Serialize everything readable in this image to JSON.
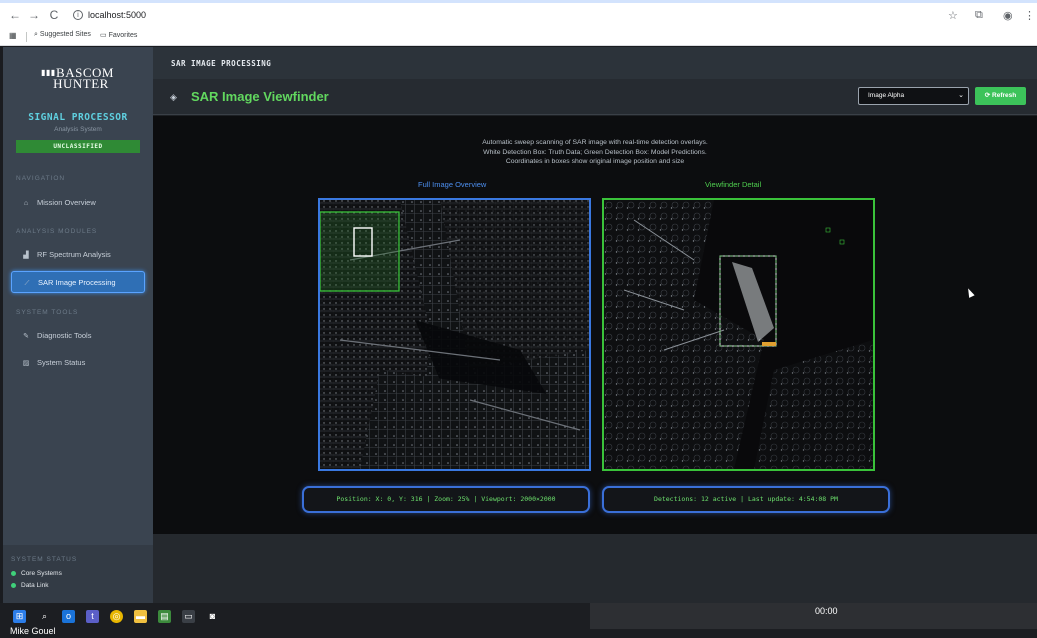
{
  "browser": {
    "url": "localhost:5000",
    "bookmarks": [
      "Suggested Sites",
      "Favorites"
    ]
  },
  "sidebar": {
    "logo_line1": "BASCOM",
    "logo_line2": "HUNTER",
    "app_title": "SIGNAL PROCESSOR",
    "app_subtitle": "Analysis System",
    "classification": "UNCLASSIFIED",
    "sections": {
      "navigation": "NAVIGATION",
      "analysis_modules": "ANALYSIS MODULES",
      "system_tools": "SYSTEM TOOLS"
    },
    "items": [
      {
        "label": "Mission Overview",
        "icon": "home-icon"
      },
      {
        "label": "RF Spectrum Analysis",
        "icon": "signal-icon"
      },
      {
        "label": "SAR Image Processing",
        "icon": "wand-icon",
        "active": true
      },
      {
        "label": "Diagnostic Tools",
        "icon": "wrench-icon"
      },
      {
        "label": "System Status",
        "icon": "chart-icon"
      }
    ],
    "status": {
      "heading": "SYSTEM STATUS",
      "lines": [
        "Core Systems",
        "Data Link"
      ],
      "ok_color": "#3fd07a"
    }
  },
  "topbar": {
    "title": "SAR IMAGE PROCESSING"
  },
  "header": {
    "title": "SAR Image Viewfinder",
    "select_value": "Image Alpha",
    "refresh_label": "Refresh",
    "accent_color": "#62d85f"
  },
  "content": {
    "desc_line1": "Automatic sweep scanning of SAR image with real-time detection overlays.",
    "desc_line2": "White Detection Box: Truth Data; Green Detection Box: Model Predictions.",
    "desc_line3": "Coordinates in boxes show original image position and size",
    "overview_label": "Full Image Overview",
    "detail_label": "Viewfinder Detail",
    "overview_readout": "Position: X: 0, Y: 316 | Zoom: 25% | Viewport: 2000×2000",
    "detail_readout": "Detections: 12 active | Last update: 4:54:08 PM"
  },
  "taskbar": {
    "time": "00:00",
    "presenter": "Mike Gouel"
  }
}
